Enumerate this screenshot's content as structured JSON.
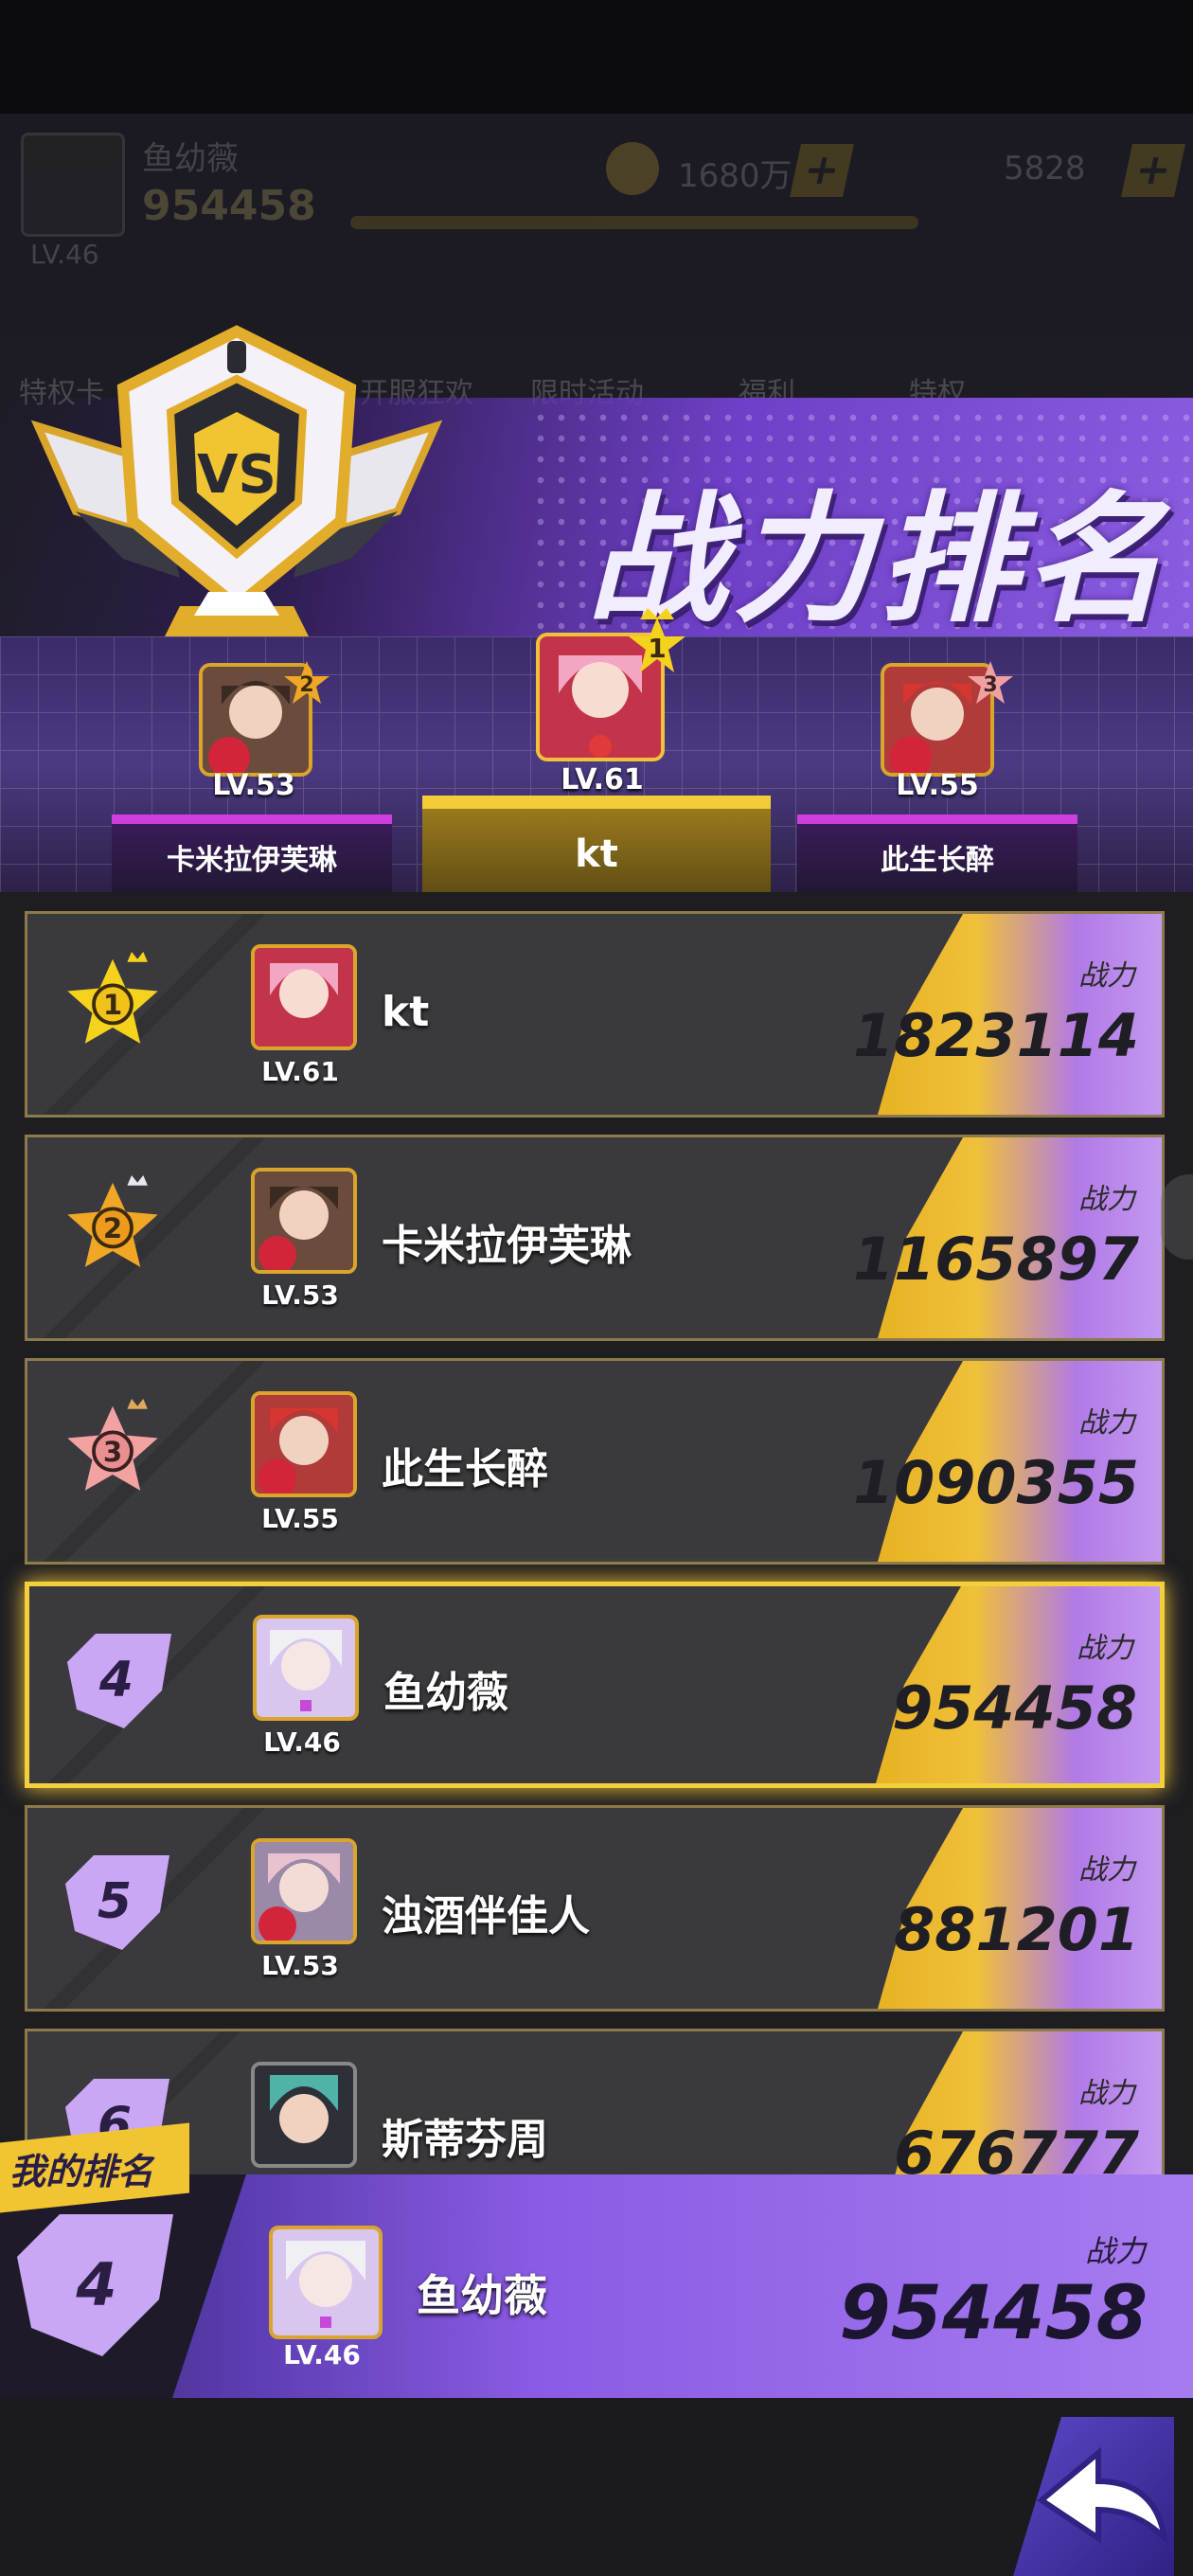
{
  "hud": {
    "player_name": "鱼幼薇",
    "player_power": "954458",
    "player_level": "LV.46",
    "gold": "1680万",
    "gems": "5828",
    "menu": [
      "特权卡",
      "开服狂欢",
      "限时活动",
      "福利",
      "特权"
    ]
  },
  "title": "战力排名",
  "podium": [
    {
      "rank": "2",
      "level": "LV.53",
      "name": "卡米拉伊芙琳"
    },
    {
      "rank": "1",
      "level": "LV.61",
      "name": "kt"
    },
    {
      "rank": "3",
      "level": "LV.55",
      "name": "此生长醉"
    }
  ],
  "power_label": "战力",
  "rows": [
    {
      "rank": "1",
      "level": "LV.61",
      "name": "kt",
      "power": "1823114"
    },
    {
      "rank": "2",
      "level": "LV.53",
      "name": "卡米拉伊芙琳",
      "power": "1165897"
    },
    {
      "rank": "3",
      "level": "LV.55",
      "name": "此生长醉",
      "power": "1090355"
    },
    {
      "rank": "4",
      "level": "LV.46",
      "name": "鱼幼薇",
      "power": "954458"
    },
    {
      "rank": "5",
      "level": "LV.53",
      "name": "浊酒伴佳人",
      "power": "881201"
    },
    {
      "rank": "6",
      "level": "",
      "name": "斯蒂芬周",
      "power": "676777"
    }
  ],
  "my_rank": {
    "tag": "我的排名",
    "rank": "4",
    "level": "LV.46",
    "name": "鱼幼薇",
    "power_label": "战力",
    "power": "954458"
  },
  "colors": {
    "gold": "#f2c13a",
    "purple": "#8b5be0",
    "row_bg": "#3a3a3e",
    "rank1": "#f5d31c",
    "rank2": "#f1a726",
    "rank3": "#f0a0a0",
    "rank_other": "#c9a7f4"
  }
}
